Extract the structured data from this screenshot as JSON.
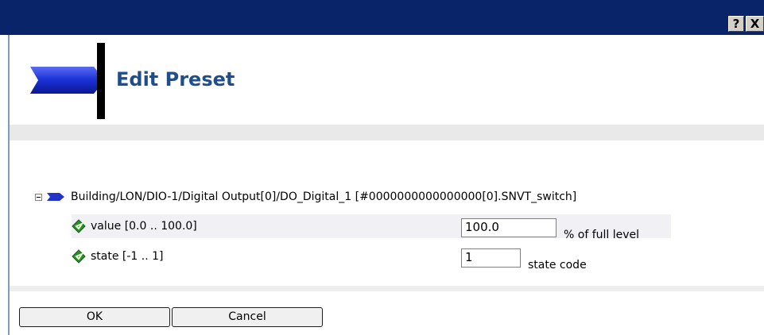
{
  "window": {
    "help_label": "?",
    "close_label": "X"
  },
  "page": {
    "title": "Edit Preset"
  },
  "tree": {
    "path": "Building/LON/DIO-1/Digital Output[0]/DO_Digital_1 [#0000000000000000[0].SNVT_switch]",
    "properties": [
      {
        "label": "value [0.0 .. 100.0]",
        "value": "100.0",
        "unit": "% of full level"
      },
      {
        "label": "state [-1 .. 1]",
        "value": "1",
        "unit": "state code"
      }
    ]
  },
  "buttons": {
    "ok_label": "OK",
    "cancel_label": "Cancel"
  },
  "colors": {
    "titlebar": "#0a246a",
    "title_text": "#1f4e8c",
    "arrow": "#2233cc",
    "diamond": "#2e8b2e"
  },
  "icons": {
    "header": "blue-arrow-icon",
    "node": "blue-arrow-icon",
    "property": "green-diamond-icon",
    "collapse": "collapse-minus-icon"
  }
}
